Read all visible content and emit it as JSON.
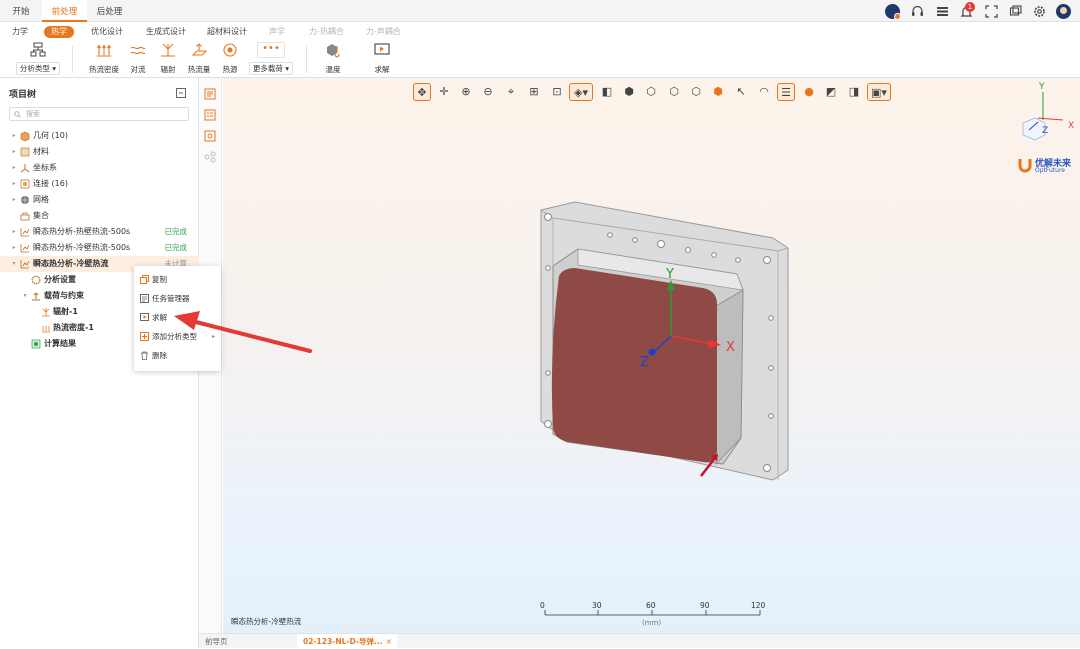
{
  "main_tabs": [
    "开始",
    "前处理",
    "后处理"
  ],
  "sub_tabs": [
    "力学",
    "热学",
    "优化设计",
    "生成式设计",
    "超材料设计",
    "声学",
    "力-热耦合",
    "力-声耦合"
  ],
  "ribbon": {
    "analysis_type": "分析类型",
    "heat_flux_density": "热流密度",
    "convection": "对流",
    "radiation": "辐射",
    "heat_flow": "热流量",
    "heat_source": "热源",
    "more_loads": "更多载荷",
    "temperature": "温度",
    "solve": "求解"
  },
  "header_right": {
    "notification_count": "1"
  },
  "project_tree": {
    "title": "项目树",
    "search_placeholder": "搜索",
    "items": [
      {
        "label": "几何 (10)",
        "status": ""
      },
      {
        "label": "材料",
        "status": ""
      },
      {
        "label": "坐标系",
        "status": ""
      },
      {
        "label": "连接 (16)",
        "status": ""
      },
      {
        "label": "网格",
        "status": ""
      },
      {
        "label": "集合",
        "status": ""
      },
      {
        "label": "瞬态热分析-热壁热流-500s",
        "status": "已完成"
      },
      {
        "label": "瞬态热分析-冷壁热流-500s",
        "status": "已完成"
      },
      {
        "label": "瞬态热分析-冷壁热流",
        "status": "未计算"
      },
      {
        "label": "分析设置",
        "status": ""
      },
      {
        "label": "载荷与约束",
        "status": ""
      },
      {
        "label": "辐射-1",
        "status": ""
      },
      {
        "label": "热流密度-1",
        "status": ""
      },
      {
        "label": "计算结果",
        "status": ""
      }
    ]
  },
  "context_menu": [
    "复制",
    "任务管理器",
    "求解",
    "添加分析类型",
    "删除"
  ],
  "viewport": {
    "axis_x": "X",
    "axis_y": "Y",
    "axis_z": "Z",
    "triad_x": "X",
    "triad_y": "Y",
    "triad_z": "Z",
    "brand_name": "优解未来",
    "brand_sub": "OptFuture",
    "scale_ticks": [
      "0",
      "30",
      "60",
      "90",
      "120"
    ],
    "scale_unit": "(mm)",
    "status_label": "瞬态热分析-冷壁热流"
  },
  "bottom_tabs": [
    "前导页",
    "02-123-NL-D-导弹..."
  ],
  "colors": {
    "accent": "#e8761e",
    "success": "#2da44e",
    "part_face": "#8f4a45",
    "housing": "#d4d4d4"
  }
}
